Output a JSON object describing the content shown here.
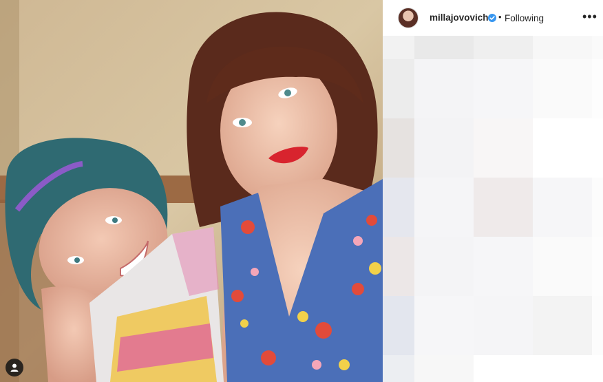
{
  "post": {
    "username": "millajovovich",
    "separator": "•",
    "follow_status": "Following",
    "more_label": "•••"
  },
  "colors": {
    "verified": "#3897f0",
    "text": "#262626"
  },
  "icons": {
    "verified": "verified-badge-icon",
    "more": "more-options-icon",
    "tagged_user": "user-tag-icon"
  },
  "blurred_tiles": [
    "#f2f2f2",
    "#e9e9e9",
    "#efefef",
    "#f7f7f7",
    "#fafafa",
    "#ececec",
    "#f4f4f6",
    "#f6f6f8",
    "#fafafa",
    "#fdfdfd",
    "#e6e2e0",
    "#f3f3f5",
    "#f8f6f6",
    "#ffffff",
    "#ffffff",
    "#e5e7ee",
    "#f5f5f7",
    "#efeaea",
    "#f6f6f8",
    "#fcfcfc",
    "#ece7e7",
    "#f4f4f6",
    "#f6f6f8",
    "#fafafa",
    "#fdfdfd",
    "#e3e6ee",
    "#f6f6f8",
    "#f5f5f7",
    "#f3f3f3",
    "#fcfcfc",
    "#eceef2",
    "#f7f7f7",
    "#ffffff",
    "#ffffff",
    "#ffffff"
  ]
}
